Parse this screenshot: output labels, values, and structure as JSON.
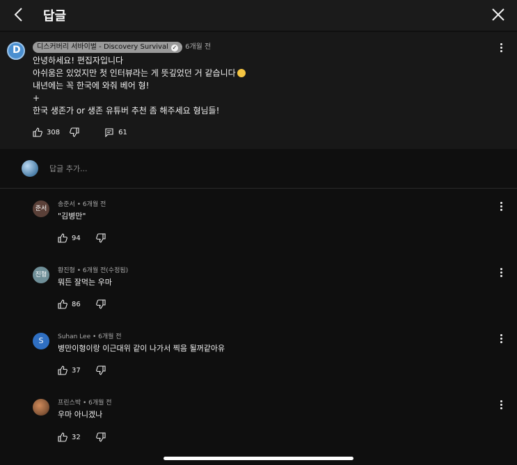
{
  "header": {
    "title": "답글"
  },
  "top_comment": {
    "channel": "디스커버리 서바이벌 - Discovery Survival",
    "time": "• 6개월 전",
    "lines": [
      "안녕하세요! 편집자입니다",
      "아쉬움은 있었지만 첫 인터뷰라는 게 뜻깊었던 거 같습니다",
      "내년에는 꼭 한국에 와줘 베어 형!",
      "+",
      "한국 생존가 or 생존 유튜버 추천 좀 해주세요 형님들!"
    ],
    "likes": "308",
    "replies": "61"
  },
  "add_reply": {
    "placeholder": "답글 추가..."
  },
  "replies": [
    {
      "avatar_text": "준서",
      "avatar_color": "#5a4038",
      "meta": "송준서 • 6개월 전",
      "text": "\"김병만\"",
      "likes": "94"
    },
    {
      "avatar_text": "진형",
      "avatar_color": "#6f8f98",
      "meta": "황진형 • 6개월 전(수정됨)",
      "text": "뭐든 잘먹는 우마",
      "likes": "86"
    },
    {
      "avatar_text": "S",
      "avatar_color": "#2f6fc2",
      "meta": "Suhan Lee • 6개월 전",
      "text": "병만이형이랑 이근대위 같이 나가서 찍음 될꺼같아유",
      "likes": "37"
    },
    {
      "avatar_text": "",
      "avatar_color": "#8a5a3a",
      "meta": "프린스박 • 6개월 전",
      "text": "우마 아니겠나",
      "likes": "32"
    }
  ]
}
